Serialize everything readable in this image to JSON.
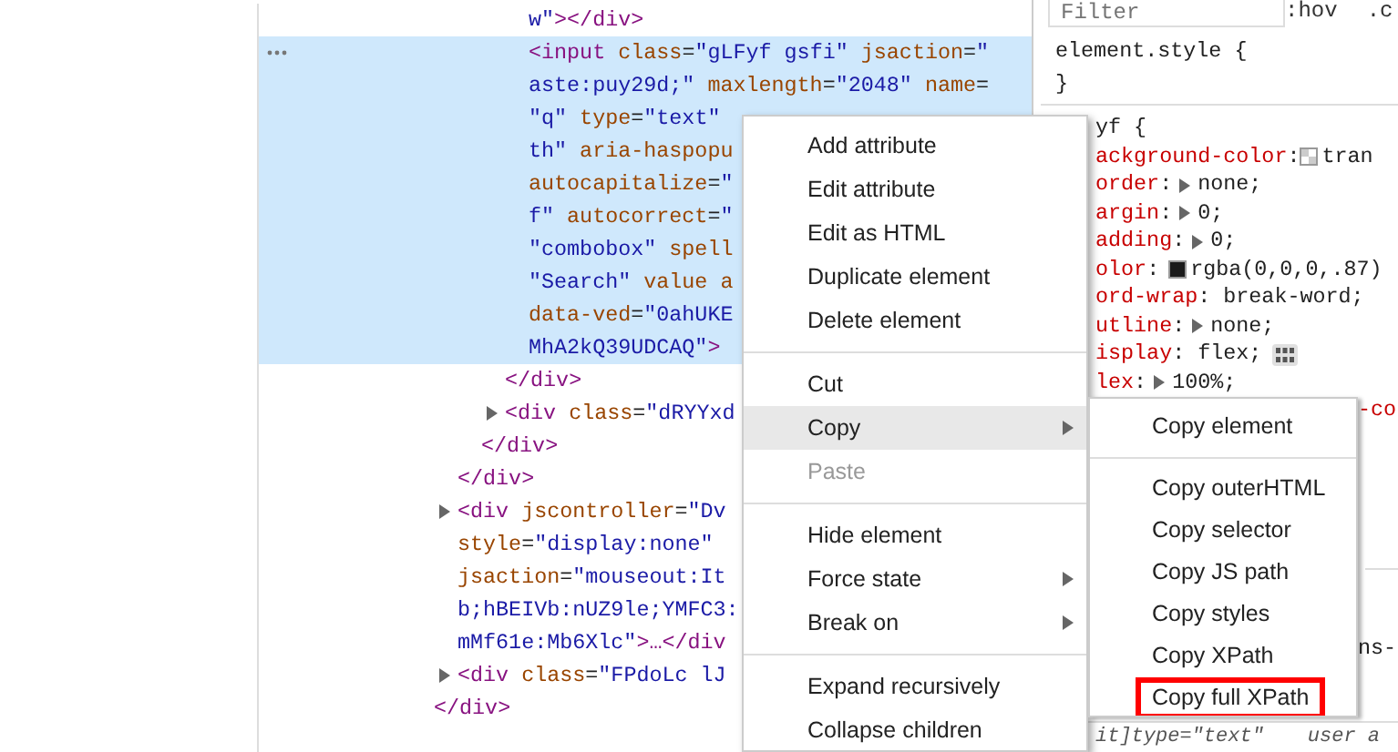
{
  "elements_panel": {
    "tree": [
      {
        "children": [
          {
            "children": [
              {
                "children": [
                  {
                    "children": [
                      {
                        "lines": [
                          [
                            {
                              "kind": "val",
                              "text": "w\""
                            },
                            {
                              "kind": "tag",
                              "text": "></div>"
                            }
                          ]
                        ]
                      },
                      {
                        "selected": true,
                        "lines": [
                          [
                            {
                              "kind": "tag",
                              "text": "<input"
                            },
                            {
                              "kind": "attr",
                              "text": " class"
                            },
                            {
                              "kind": "text",
                              "text": "="
                            },
                            {
                              "kind": "val",
                              "text": "\"gLFyf gsfi\""
                            },
                            {
                              "kind": "attr",
                              "text": " jsaction"
                            },
                            {
                              "kind": "text",
                              "text": "="
                            },
                            {
                              "kind": "val",
                              "text": "\""
                            }
                          ],
                          [
                            {
                              "kind": "val",
                              "text": "aste:puy29d;\""
                            },
                            {
                              "kind": "attr",
                              "text": " maxlength"
                            },
                            {
                              "kind": "text",
                              "text": "="
                            },
                            {
                              "kind": "val",
                              "text": "\"2048\""
                            },
                            {
                              "kind": "attr",
                              "text": " name"
                            },
                            {
                              "kind": "text",
                              "text": "="
                            }
                          ],
                          [
                            {
                              "kind": "val",
                              "text": "\"q\""
                            },
                            {
                              "kind": "attr",
                              "text": " type"
                            },
                            {
                              "kind": "text",
                              "text": "="
                            },
                            {
                              "kind": "val",
                              "text": "\"text\""
                            }
                          ],
                          [
                            {
                              "kind": "val",
                              "text": "th\""
                            },
                            {
                              "kind": "attr",
                              "text": " aria-haspopu"
                            }
                          ],
                          [
                            {
                              "kind": "attr",
                              "text": "autocapitalize"
                            },
                            {
                              "kind": "text",
                              "text": "="
                            },
                            {
                              "kind": "val",
                              "text": "\""
                            }
                          ],
                          [
                            {
                              "kind": "val",
                              "text": "f\""
                            },
                            {
                              "kind": "attr",
                              "text": " autocorrect"
                            },
                            {
                              "kind": "text",
                              "text": "="
                            },
                            {
                              "kind": "val",
                              "text": "\""
                            }
                          ],
                          [
                            {
                              "kind": "val",
                              "text": "\"combobox\""
                            },
                            {
                              "kind": "attr",
                              "text": " spell"
                            }
                          ],
                          [
                            {
                              "kind": "val",
                              "text": "\"Search\""
                            },
                            {
                              "kind": "attr",
                              "text": " value a"
                            }
                          ],
                          [
                            {
                              "kind": "attr",
                              "text": "data-ved"
                            },
                            {
                              "kind": "text",
                              "text": "="
                            },
                            {
                              "kind": "val",
                              "text": "\"0ahUKE"
                            }
                          ],
                          [
                            {
                              "kind": "val",
                              "text": "MhA2kQ39UDCAQ\""
                            },
                            {
                              "kind": "tag",
                              "text": ">"
                            }
                          ]
                        ]
                      }
                    ]
                  },
                  {
                    "lines": [
                      [
                        {
                          "kind": "tag",
                          "text": "</div>"
                        }
                      ]
                    ]
                  },
                  {
                    "expandable": true,
                    "lines": [
                      [
                        {
                          "kind": "tag",
                          "text": "<div"
                        },
                        {
                          "kind": "attr",
                          "text": " class"
                        },
                        {
                          "kind": "text",
                          "text": "="
                        },
                        {
                          "kind": "val",
                          "text": "\"dRYYxd"
                        }
                      ]
                    ]
                  }
                ]
              },
              {
                "lines": [
                  [
                    {
                      "kind": "tag",
                      "text": "</div>"
                    }
                  ]
                ]
              }
            ]
          },
          {
            "lines": [
              [
                {
                  "kind": "tag",
                  "text": "</div>"
                }
              ]
            ]
          },
          {
            "expandable": true,
            "lines": [
              [
                {
                  "kind": "tag",
                  "text": "<div"
                },
                {
                  "kind": "attr",
                  "text": " jscontroller"
                },
                {
                  "kind": "text",
                  "text": "="
                },
                {
                  "kind": "val",
                  "text": "\"Dv"
                }
              ],
              [
                {
                  "kind": "attr",
                  "text": "style"
                },
                {
                  "kind": "text",
                  "text": "="
                },
                {
                  "kind": "val",
                  "text": "\"display:none\""
                }
              ],
              [
                {
                  "kind": "attr",
                  "text": "jsaction"
                },
                {
                  "kind": "text",
                  "text": "="
                },
                {
                  "kind": "val",
                  "text": "\"mouseout:It"
                }
              ],
              [
                {
                  "kind": "val",
                  "text": "b;hBEIVb:nUZ9le;YMFC3:"
                }
              ],
              [
                {
                  "kind": "val",
                  "text": "mMf61e:Mb6Xlc\""
                },
                {
                  "kind": "tag",
                  "text": ">…</div"
                }
              ]
            ]
          },
          {
            "expandable": true,
            "lines": [
              [
                {
                  "kind": "tag",
                  "text": "<div"
                },
                {
                  "kind": "attr",
                  "text": " class"
                },
                {
                  "kind": "text",
                  "text": "="
                },
                {
                  "kind": "val",
                  "text": "\"FPdoLc lJ"
                }
              ]
            ]
          }
        ]
      },
      {
        "lines": [
          [
            {
              "kind": "tag",
              "text": "</div>"
            }
          ]
        ]
      }
    ]
  },
  "styles_panel": {
    "filter": {
      "placeholder": "Filter"
    },
    "hov": ":hov",
    "cls": ".c",
    "element_style": [
      "element.style {",
      "}"
    ],
    "rule_lines": [
      [
        {
          "kind": "sel",
          "text": "yf {"
        }
      ],
      [
        {
          "kind": "prop",
          "text": "ackground-color"
        },
        {
          "kind": "text",
          "text": ":"
        },
        {
          "kind": "checker"
        },
        {
          "kind": "text",
          "text": "tran"
        }
      ],
      [
        {
          "kind": "prop",
          "text": "order"
        },
        {
          "kind": "text",
          "text": ":"
        },
        {
          "kind": "tri"
        },
        {
          "kind": "text",
          "text": "none;"
        }
      ],
      [
        {
          "kind": "prop",
          "text": "argin"
        },
        {
          "kind": "text",
          "text": ":"
        },
        {
          "kind": "tri"
        },
        {
          "kind": "text",
          "text": "0;"
        }
      ],
      [
        {
          "kind": "prop",
          "text": "adding"
        },
        {
          "kind": "text",
          "text": ":"
        },
        {
          "kind": "tri"
        },
        {
          "kind": "text",
          "text": "0;"
        }
      ],
      [
        {
          "kind": "prop",
          "text": "olor"
        },
        {
          "kind": "text",
          "text": ":"
        },
        {
          "kind": "swatch",
          "color": "#1a1a1a"
        },
        {
          "kind": "text",
          "text": "rgba(0,0,0,.87)"
        }
      ],
      [
        {
          "kind": "prop",
          "text": "ord-wrap"
        },
        {
          "kind": "text",
          "text": ": break-word;"
        }
      ],
      [
        {
          "kind": "prop",
          "text": "utline"
        },
        {
          "kind": "text",
          "text": ":"
        },
        {
          "kind": "tri"
        },
        {
          "kind": "text",
          "text": "none;"
        }
      ],
      [
        {
          "kind": "prop",
          "text": "isplay"
        },
        {
          "kind": "text",
          "text": ": flex;"
        },
        {
          "kind": "grid"
        }
      ],
      [
        {
          "kind": "prop",
          "text": "lex"
        },
        {
          "kind": "text",
          "text": ":"
        },
        {
          "kind": "tri"
        },
        {
          "kind": "text",
          "text": "100%;"
        }
      ]
    ],
    "cut_line": "-co",
    "second_rule_line": "ns-",
    "ua_selector": "it]type=\"text\"",
    "ua_origin": "user a"
  },
  "context_menu": {
    "items": [
      {
        "kind": "item",
        "label": "Add attribute",
        "selected": false,
        "disabled": false,
        "submenu": false
      },
      {
        "kind": "item",
        "label": "Edit attribute",
        "selected": false,
        "disabled": false,
        "submenu": false
      },
      {
        "kind": "item",
        "label": "Edit as HTML",
        "selected": false,
        "disabled": false,
        "submenu": false
      },
      {
        "kind": "item",
        "label": "Duplicate element",
        "selected": false,
        "disabled": false,
        "submenu": false
      },
      {
        "kind": "item",
        "label": "Delete element",
        "selected": false,
        "disabled": false,
        "submenu": false
      },
      {
        "kind": "separator"
      },
      {
        "kind": "item",
        "label": "Cut",
        "selected": false,
        "disabled": false,
        "submenu": false
      },
      {
        "kind": "item",
        "label": "Copy",
        "selected": true,
        "disabled": false,
        "submenu": true
      },
      {
        "kind": "item",
        "label": "Paste",
        "selected": false,
        "disabled": true,
        "submenu": false
      },
      {
        "kind": "separator"
      },
      {
        "kind": "item",
        "label": "Hide element",
        "selected": false,
        "disabled": false,
        "submenu": false
      },
      {
        "kind": "item",
        "label": "Force state",
        "selected": false,
        "disabled": false,
        "submenu": true
      },
      {
        "kind": "item",
        "label": "Break on",
        "selected": false,
        "disabled": false,
        "submenu": true
      },
      {
        "kind": "separator"
      },
      {
        "kind": "item",
        "label": "Expand recursively",
        "selected": false,
        "disabled": false,
        "submenu": false
      },
      {
        "kind": "item",
        "label": "Collapse children",
        "selected": false,
        "disabled": false,
        "submenu": false
      }
    ]
  },
  "submenu": {
    "items": [
      {
        "kind": "item",
        "label": "Copy element",
        "annotated": false
      },
      {
        "kind": "separator"
      },
      {
        "kind": "item",
        "label": "Copy outerHTML",
        "annotated": false
      },
      {
        "kind": "item",
        "label": "Copy selector",
        "annotated": false
      },
      {
        "kind": "item",
        "label": "Copy JS path",
        "annotated": false
      },
      {
        "kind": "item",
        "label": "Copy styles",
        "annotated": false
      },
      {
        "kind": "item",
        "label": "Copy XPath",
        "annotated": false
      },
      {
        "kind": "item",
        "label": "Copy full XPath",
        "annotated": true
      }
    ]
  }
}
